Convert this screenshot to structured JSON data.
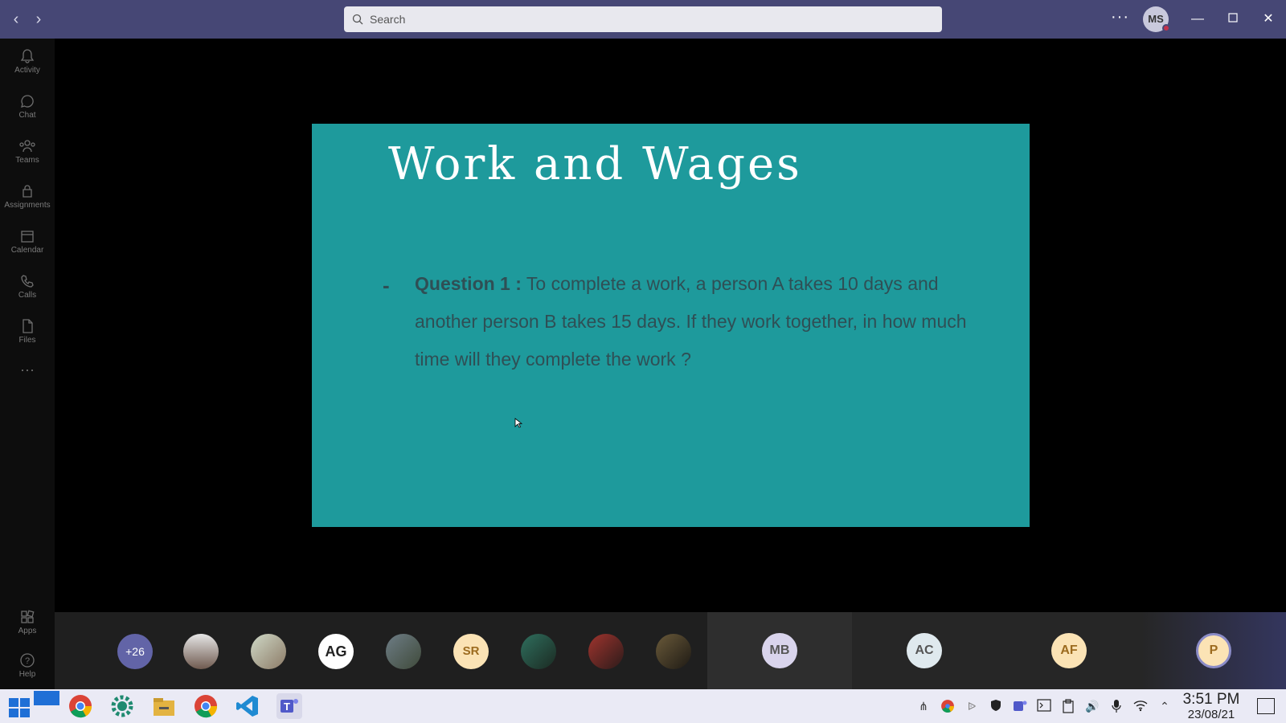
{
  "titlebar": {
    "search_placeholder": "Search",
    "more_label": "···",
    "avatar_initials": "MS"
  },
  "rail": {
    "items": [
      {
        "label": "Activity",
        "icon": "bell-icon"
      },
      {
        "label": "Chat",
        "icon": "chat-icon"
      },
      {
        "label": "Teams",
        "icon": "teams-icon"
      },
      {
        "label": "Assignments",
        "icon": "assignments-icon"
      },
      {
        "label": "Calendar",
        "icon": "calendar-icon"
      },
      {
        "label": "Calls",
        "icon": "phone-icon"
      },
      {
        "label": "Files",
        "icon": "file-icon"
      }
    ],
    "more_label": "···",
    "apps_label": "Apps",
    "help_label": "Help"
  },
  "slide": {
    "title": "Work and Wages",
    "bullet": "-",
    "question_label": "Question 1 :",
    "question_text": " To complete a work, a person A takes 10 days and another person B takes 15 days. If they work together, in how much time will they complete the work ?",
    "background": "#1e9a9c"
  },
  "participants": {
    "overflow_count": "+26",
    "initials": [
      "AG",
      "SR"
    ],
    "tiles": [
      {
        "initials": "MB",
        "color": "#d9d4ec"
      },
      {
        "initials": "AC",
        "color": "#dfe9ee"
      },
      {
        "initials": "AF",
        "color": "#fbe3b5"
      },
      {
        "initials": "P",
        "color": "#fbe3b5"
      }
    ]
  },
  "taskbar": {
    "time": "3:51 PM",
    "date": "23/08/21"
  }
}
